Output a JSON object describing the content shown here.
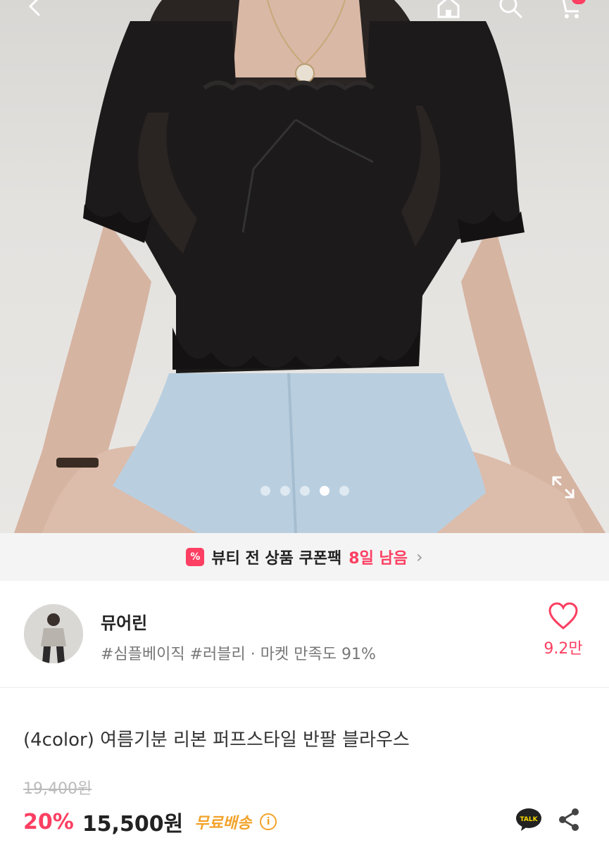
{
  "topbar": {
    "back_icon": "chevron-left-icon",
    "home_icon": "home-icon",
    "search_icon": "search-icon",
    "cart_icon": "cart-icon"
  },
  "gallery": {
    "total_images": 5,
    "active_index": 4,
    "expand_icon": "expand-icon"
  },
  "coupon": {
    "icon_text": "%",
    "text": "뷰티 전 상품 쿠폰팩",
    "highlight": "8일 남음",
    "chevron": "›"
  },
  "store": {
    "name": "뮤어린",
    "meta": "#심플베이직 #러블리 · 마켓 만족도 91%",
    "likes": "9.2만"
  },
  "product": {
    "title": "(4color) 여름기분 리본 퍼프스타일 반팔 블라우스",
    "original_price": "19,400원",
    "discount": "20%",
    "price": "15,500원",
    "shipping": "무료배송",
    "info_icon_text": "i"
  },
  "colors": {
    "accent": "#fc3f62",
    "shipping": "#f2a32a"
  }
}
